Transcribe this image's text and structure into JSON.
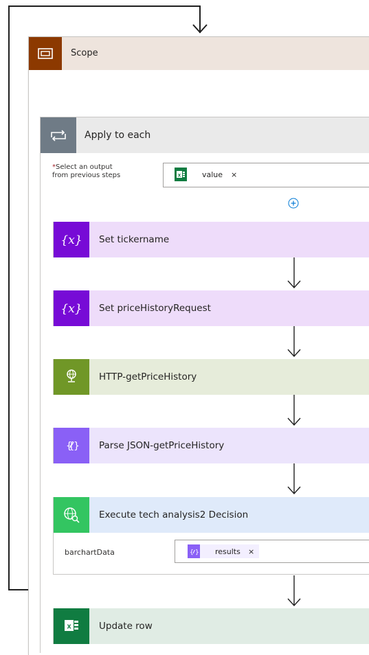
{
  "scope": {
    "title": "Scope"
  },
  "foreach": {
    "title": "Apply to each",
    "required_mark": "*",
    "field_label_line1": "Select an output",
    "field_label_line2": "from previous steps",
    "token_label": "value",
    "token_remove": "×"
  },
  "actions": [
    {
      "title": "Set tickername",
      "icon": "variable-icon"
    },
    {
      "title": "Set priceHistoryRequest",
      "icon": "variable-icon"
    },
    {
      "title": "HTTP-getPriceHistory",
      "icon": "globe-icon"
    },
    {
      "title": "Parse JSON-getPriceHistory",
      "icon": "parse-json-icon"
    },
    {
      "title": "Execute tech analysis2 Decision",
      "icon": "globe-search-icon"
    },
    {
      "title": "Update row",
      "icon": "excel-icon"
    }
  ],
  "execute": {
    "field_label": "barchartData",
    "token_label": "results",
    "token_remove": "×"
  },
  "colors": {
    "scope_icon": "#8c3900",
    "foreach_icon": "#6f7b86",
    "variable_icon": "#770bd6",
    "http_icon": "#709727",
    "parse_icon": "#8a60f6",
    "execute_icon": "#33c561",
    "excel_icon": "#107c41"
  }
}
